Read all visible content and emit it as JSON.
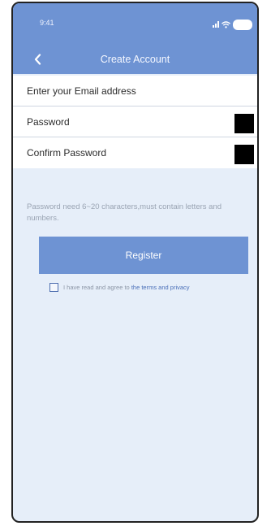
{
  "status_bar": {
    "time": "9:41"
  },
  "nav": {
    "title": "Create Account",
    "back_icon": "chevron-left-icon"
  },
  "form": {
    "email_placeholder": "Enter your Email address",
    "password_placeholder": "Password",
    "confirm_password_placeholder": "Confirm Password"
  },
  "hint": "Password need 6~20 characters,must contain letters and numbers.",
  "register_label": "Register",
  "agreement": {
    "checked": false,
    "text": "I have read and agree to",
    "link_text": "the terms and privacy"
  },
  "colors": {
    "accent": "#6e93d3",
    "background": "#e6eef9",
    "link": "#4a6fb8"
  }
}
